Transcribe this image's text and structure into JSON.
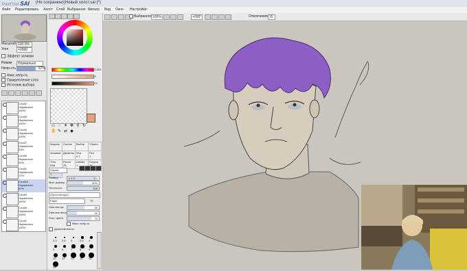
{
  "app": {
    "logo_prefix": "PaintTool",
    "logo_name": "SAI",
    "document_title": "(Не сохранено)Новый холст.sai (*)"
  },
  "menu": [
    "Файл",
    "Редактировать",
    "Холст",
    "Слой",
    "Выбранное",
    "Фильтр",
    "Вид",
    "Окно",
    "Настройки"
  ],
  "toolbar": {
    "selection_label": "Выбранное",
    "zoom": "100%",
    "angle": "+000°",
    "stabilizer_label": "Отвлечение",
    "stabilizer_value": "15"
  },
  "navigator": {
    "zoom_label": "Масштаб",
    "zoom_value": "100.0%",
    "angle_label": "Угол",
    "angle_value": "+0000"
  },
  "layer_panel": {
    "effect_label": "Эффект заливки",
    "blend_label": "Режим",
    "blend_value": "Нормально",
    "opacity_label": "Непр-сть",
    "opacity_value": "67%",
    "opacity_fraction": 0.67,
    "checkbox_1": "Фикс.непр-ть",
    "checkbox_2": "Прикрепление слоя",
    "checkbox_3": "Источник выбора"
  },
  "layers": [
    {
      "name": "Слой2",
      "mode": "Нормально",
      "opacity": "100%",
      "selected": false
    },
    {
      "name": "Слой5",
      "mode": "Нормально",
      "opacity": "100%",
      "selected": false
    },
    {
      "name": "Слой4",
      "mode": "Нормально",
      "opacity": "100%",
      "selected": false
    },
    {
      "name": "Слой7",
      "mode": "Нормально",
      "opacity": "33%",
      "selected": false
    },
    {
      "name": "Слой6",
      "mode": "Нормально",
      "opacity": "25%",
      "selected": false
    },
    {
      "name": "Слой1",
      "mode": "Нормально",
      "opacity": "17%",
      "selected": false
    },
    {
      "name": "Слой10",
      "mode": "Нормально",
      "opacity": "67%",
      "selected": true
    },
    {
      "name": "Слой3",
      "mode": "Нормально",
      "opacity": "100%",
      "selected": false
    },
    {
      "name": "Слой9",
      "mode": "Нормально",
      "opacity": "100%",
      "selected": false
    },
    {
      "name": "Слой1",
      "mode": "Нормально",
      "opacity": "100%",
      "selected": false
    }
  ],
  "color": {
    "h": "0.083",
    "s": "9",
    "v": "23",
    "primary": "#e8a07d"
  },
  "tools": [
    {
      "name": "Маркер",
      "size": ""
    },
    {
      "name": "Ластик",
      "size": ""
    },
    {
      "name": "Выбор",
      "size": ""
    },
    {
      "name": "Убрать",
      "size": ""
    },
    {
      "name": "Заливка",
      "size": ""
    },
    {
      "name": "Двойная",
      "size": ""
    },
    {
      "name": "Sha",
      "size": "0.7"
    },
    {
      "name": "Pen",
      "size": "1"
    },
    {
      "name": "Thro",
      "size": "Wat"
    },
    {
      "name": "Pencil",
      "size": "28"
    },
    {
      "name": "Details",
      "size": "1"
    },
    {
      "name": "Crayon",
      "size": "28"
    },
    {
      "name": "Paper",
      "size": "1"
    }
  ],
  "brush_props": {
    "mode": "Норма",
    "size_label": "Размер",
    "size_mult": "x 1.0",
    "size_value": "9.0",
    "min_size_label": "Мин. размер",
    "min_size_value": "50%",
    "density_label": "Плотность",
    "density_value": "100",
    "shape": "(Простой круг)",
    "texture": "Paper",
    "texture_value": "70",
    "blend_label": "Сме-ние цв.",
    "blend_value": "55",
    "dilution_label": "Сме-ние непр.",
    "dilution_value": "30",
    "persistence_label": "Раст. цвета",
    "persistence_value": "75",
    "keep_opacity": "Фикс. непр-ть",
    "advanced": "Дополнительно"
  },
  "brush_sizes": [
    "2.3",
    "2.6",
    "3",
    "3.5",
    "4",
    "5",
    "6",
    "7",
    "8",
    "9",
    "10",
    "12",
    "14",
    "16",
    "20",
    "25"
  ]
}
